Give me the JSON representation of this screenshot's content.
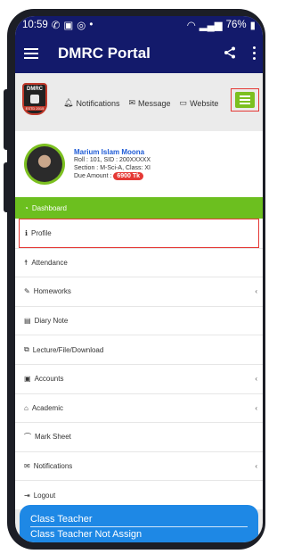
{
  "status": {
    "time": "10:59",
    "battery": "76%"
  },
  "app": {
    "title": "DMRC Portal"
  },
  "nav": {
    "logo_text_top": "DMRC",
    "logo_text_bottom": "ESTD 2015",
    "notifications": "Notifications",
    "message": "Message",
    "website": "Website"
  },
  "profile": {
    "name": "Marium Islam Moona",
    "roll_label": "Roll : ",
    "roll": "101",
    "sid_label": ", SID : ",
    "sid": "200XXXXX",
    "section_label": "Section : ",
    "section": "M-Sci-A",
    "class_label": ", Class: ",
    "class": "XI",
    "due_label": "Due Amount : ",
    "due": "6900 Tk"
  },
  "menu": {
    "dashboard": "Dashboard",
    "items": [
      {
        "label": "Profile",
        "icon": "info-icon"
      },
      {
        "label": "Attendance",
        "icon": "person-icon"
      },
      {
        "label": "Homeworks",
        "icon": "edit-icon"
      },
      {
        "label": "Diary Note",
        "icon": "book-icon"
      },
      {
        "label": "Lecture/File/Download",
        "icon": "clone-icon"
      },
      {
        "label": "Accounts",
        "icon": "money-icon"
      },
      {
        "label": "Academic",
        "icon": "bank-icon"
      },
      {
        "label": "Mark Sheet",
        "icon": "graduation-icon"
      },
      {
        "label": "Notifications",
        "icon": "envelope-icon"
      },
      {
        "label": "Logout",
        "icon": "logout-icon"
      }
    ]
  },
  "footer": {
    "title": "Class Teacher",
    "value": "Class Teacher Not Assign"
  },
  "colors": {
    "primary": "#131a6b",
    "green": "#6cbf1f",
    "red": "#e53935",
    "blue": "#1e88e5"
  }
}
